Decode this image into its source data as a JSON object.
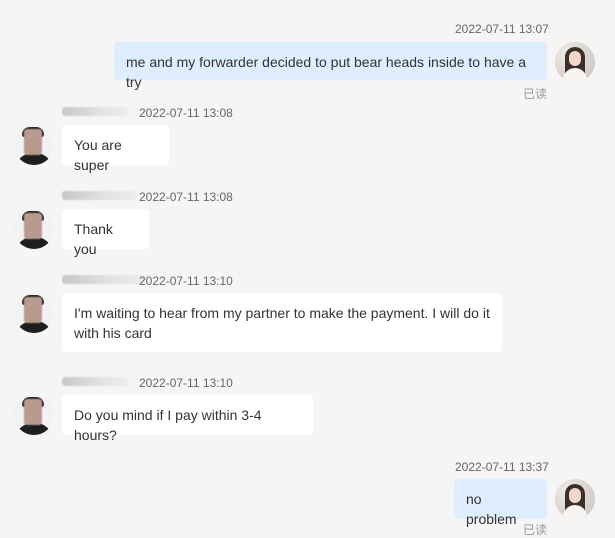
{
  "messages": [
    {
      "direction": "out",
      "time": "2022-07-11 13:07",
      "text": "me and my forwarder decided to put bear heads inside to have a try",
      "read": "已读"
    },
    {
      "direction": "in",
      "sender": "Ata Ozdogan",
      "time": "2022-07-11 13:08",
      "text": "You are super"
    },
    {
      "direction": "in",
      "sender": "Ata Ozdogan",
      "time": "2022-07-11 13:08",
      "text": "Thank you"
    },
    {
      "direction": "in",
      "sender": "Ata Ozdogan",
      "time": "2022-07-11 13:10",
      "text": "I'm waiting to hear from my partner to make the payment. I will do it with his card"
    },
    {
      "direction": "in",
      "sender": "Ata Ozdogan",
      "time": "2022-07-11 13:10",
      "text": "Do you mind if I pay within 3-4 hours?"
    },
    {
      "direction": "out",
      "time": "2022-07-11 13:37",
      "text": "no problem",
      "read": "已读"
    }
  ]
}
